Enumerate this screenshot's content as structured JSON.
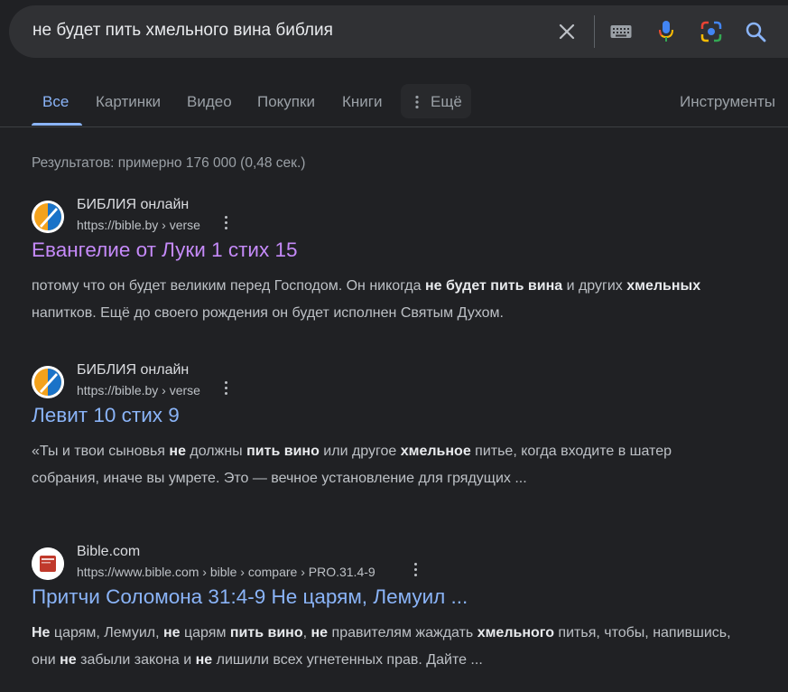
{
  "search": {
    "query": "не будет пить хмельного вина библия"
  },
  "tabs": {
    "items": [
      "Все",
      "Картинки",
      "Видео",
      "Покупки",
      "Книги"
    ],
    "more_label": "Ещё",
    "tools_label": "Инструменты"
  },
  "stats": "Результатов: примерно 176 000 (0,48 сек.)",
  "results": [
    {
      "site": "БИБЛИЯ онлайн",
      "url": "https://bible.by › verse",
      "title": "Евангелие от Луки 1 стих 15",
      "snippet": [
        {
          "t": "потому что он будет великим перед Господом. Он никогда ",
          "b": false
        },
        {
          "t": "не будет пить вина",
          "b": true
        },
        {
          "t": " и других ",
          "b": false
        },
        {
          "t": "хмельных",
          "b": true
        },
        {
          "t": " напитков. Ещё до своего рождения он будет исполнен Святым Духом.",
          "b": false
        }
      ]
    },
    {
      "site": "БИБЛИЯ онлайн",
      "url": "https://bible.by › verse",
      "title": "Левит 10 стих 9",
      "snippet": [
        {
          "t": "«Ты и твои сыновья ",
          "b": false
        },
        {
          "t": "не",
          "b": true
        },
        {
          "t": " должны ",
          "b": false
        },
        {
          "t": "пить вино",
          "b": true
        },
        {
          "t": " или другое ",
          "b": false
        },
        {
          "t": "хмельное",
          "b": true
        },
        {
          "t": " питье, когда входите в шатер собрания, иначе вы умрете. Это — вечное установление для грядущих ...",
          "b": false
        }
      ]
    },
    {
      "site": "Bible.com",
      "url": "https://www.bible.com › bible › compare › PRO.31.4-9",
      "title": "Притчи Соломона 31:4-9 Не царям, Лемуил ...",
      "snippet": [
        {
          "t": "Не",
          "b": true
        },
        {
          "t": " царям, Лемуил, ",
          "b": false
        },
        {
          "t": "не",
          "b": true
        },
        {
          "t": " царям ",
          "b": false
        },
        {
          "t": "пить вино",
          "b": true
        },
        {
          "t": ", ",
          "b": false
        },
        {
          "t": "не",
          "b": true
        },
        {
          "t": " правителям жаждать ",
          "b": false
        },
        {
          "t": "хмельного",
          "b": true
        },
        {
          "t": " питья, чтобы, напившись, они ",
          "b": false
        },
        {
          "t": "не",
          "b": true
        },
        {
          "t": " забыли закона и ",
          "b": false
        },
        {
          "t": "не",
          "b": true
        },
        {
          "t": " лишили всех угнетенных прав. Дайте ...",
          "b": false
        }
      ]
    }
  ]
}
